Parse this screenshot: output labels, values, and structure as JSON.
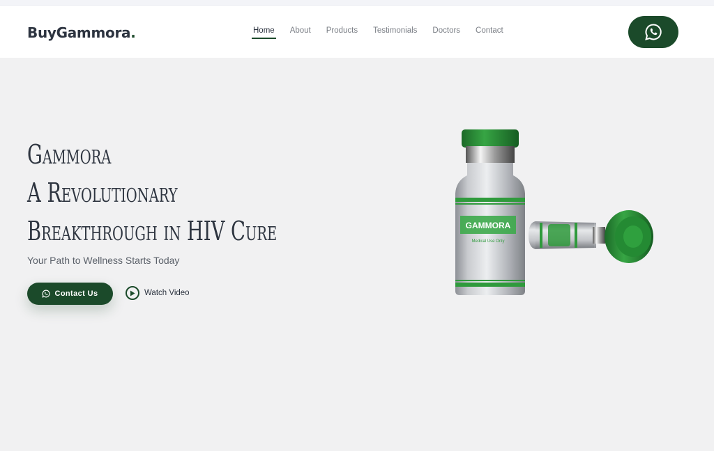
{
  "header": {
    "logo": "BuyGammora",
    "logo_dot": ".",
    "nav": [
      {
        "label": "Home",
        "active": true
      },
      {
        "label": "About"
      },
      {
        "label": "Products"
      },
      {
        "label": "Testimonials"
      },
      {
        "label": "Doctors"
      },
      {
        "label": "Contact"
      }
    ],
    "whatsapp_icon": "whatsapp-icon"
  },
  "hero": {
    "title_lines": [
      "Gammora",
      "A Revolutionary",
      "Breakthrough in HIV Cure"
    ],
    "subtitle": "Your Path to Wellness Starts Today",
    "contact_label": "Contact Us",
    "watch_label": "Watch Video",
    "vial_brand": "GAMMORA",
    "vial_small": "Medical Use Only"
  },
  "colors": {
    "accent": "#1b4a2a",
    "background": "#f1f1f2",
    "vial_green": "#2f9a3c"
  }
}
